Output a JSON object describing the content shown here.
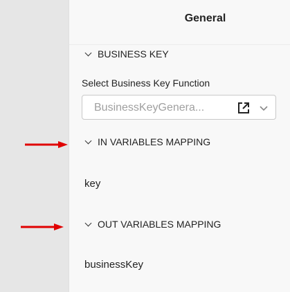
{
  "panel": {
    "title": "General"
  },
  "sections": {
    "business_key": {
      "label": "BUSINESS KEY",
      "field_label": "Select Business Key Function",
      "select_placeholder": "BusinessKeyGenera..."
    },
    "in_variables": {
      "label": "IN VARIABLES MAPPING",
      "value": "key"
    },
    "out_variables": {
      "label": "OUT VARIABLES MAPPING",
      "value": "businessKey"
    }
  },
  "icons": {
    "open": "external-link-icon",
    "caret": "chevron-down-icon",
    "section_toggle": "chevron-down-icon",
    "annotation": "arrow-right-icon"
  },
  "colors": {
    "annotation_arrow": "#e00000",
    "gutter": "#e6e6e6",
    "panel_bg": "#f8f8f8",
    "placeholder": "#a0a0a0"
  }
}
